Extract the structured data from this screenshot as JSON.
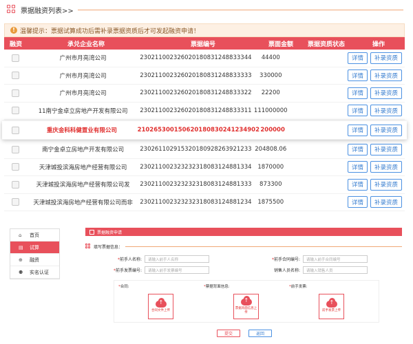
{
  "list": {
    "title": "票据融资列表>>",
    "notice": "温馨提示：票据试算成功后需补录票据资质后才可发起融资申请！",
    "headers": [
      "融资",
      "承兑企业名称",
      "票据编号",
      "票面金额",
      "票据资质状态",
      "操作"
    ],
    "detail_label": "详情",
    "supplement_label": "补录资质",
    "rows": [
      {
        "company": "广州市月亮湾公司",
        "bill_no": "230211002326020180831248833344",
        "amount": "44400",
        "highlight": false
      },
      {
        "company": "广州市月亮湾公司",
        "bill_no": "230211002326020180831248833333",
        "amount": "330000",
        "highlight": false
      },
      {
        "company": "广州市月亮湾公司",
        "bill_no": "230211002326020180831248833322",
        "amount": "22200",
        "highlight": false
      },
      {
        "company": "11南宁金卓立房地产开发有限公司",
        "bill_no": "230211002326020180831248833311",
        "amount": "111000000",
        "highlight": false
      },
      {
        "company": "重庆金科科健置业有限公司",
        "bill_no": "210265300150620180830241234902",
        "amount": "200000",
        "highlight": true
      },
      {
        "company": "南宁金卓立房地产开发有限公司",
        "bill_no": "230261102915320180928263921233",
        "amount": "204808.06",
        "highlight": false
      },
      {
        "company": "天津城投滨海房地产经营有限公司",
        "bill_no": "230211002323232318083124881334",
        "amount": "1870000",
        "highlight": false
      },
      {
        "company": "天津城投滨海房地产经营有限公司发",
        "bill_no": "230211002323232318083124881333",
        "amount": "873300",
        "highlight": false
      },
      {
        "company": "天津城投滨海房地产经营有限公司而非",
        "bill_no": "230211002323232318083124881234",
        "amount": "1875500",
        "highlight": false
      }
    ]
  },
  "nav": {
    "items": [
      {
        "label": "首页",
        "icon": "home-icon",
        "glyph": "⌂",
        "active": false
      },
      {
        "label": "试算",
        "icon": "calc-icon",
        "glyph": "▤",
        "active": true
      },
      {
        "label": "融资",
        "icon": "finance-icon",
        "glyph": "⊕",
        "active": false
      },
      {
        "label": "实名认证",
        "icon": "user-icon",
        "glyph": "⚉",
        "active": false
      }
    ]
  },
  "apply": {
    "bar_title": "票据融资申请",
    "form_title": "填写票据信息：",
    "fields": {
      "prev_name": {
        "label": "前手人名称:",
        "placeholder": "请输入前手人名称"
      },
      "prev_contract_no": {
        "label": "前手合同编号:",
        "placeholder": "请输入前手合同编号"
      },
      "prev_invoice_no": {
        "label": "前手发票编号:",
        "placeholder": "请输入前手发票编号"
      },
      "seller_name": {
        "label": "销售人员名称:",
        "placeholder": "请输入销售人员"
      }
    },
    "uploads": [
      {
        "header": "合同:",
        "button": "合同文件上传"
      },
      {
        "header": "票据背面信息:",
        "button": "票据背面信息上传"
      },
      {
        "header": "前手发票:",
        "button": "前手发票上传"
      }
    ],
    "submit_label": "提交",
    "back_label": "返回"
  },
  "colors": {
    "accent": "#e8505b",
    "link": "#3a7fd0",
    "notice_bg": "#fdf0e3"
  }
}
